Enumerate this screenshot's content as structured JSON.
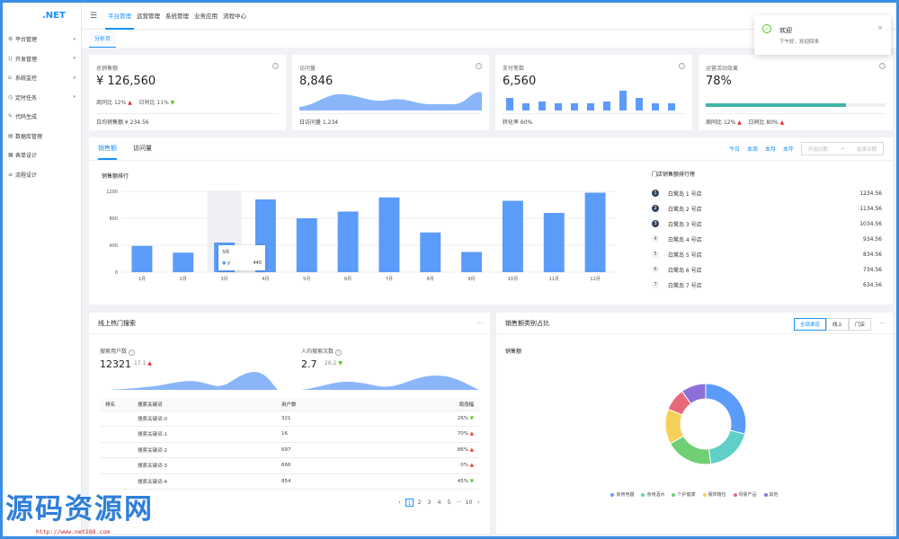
{
  "app": {
    "logo": ".NET"
  },
  "sidebar": {
    "items": [
      {
        "label": "平台管理",
        "icon": "gear-icon",
        "has_arrow": true
      },
      {
        "label": "开发管理",
        "icon": "code-icon",
        "has_arrow": true
      },
      {
        "label": "系统监控",
        "icon": "monitor-icon",
        "has_arrow": true
      },
      {
        "label": "定时任务",
        "icon": "clock-icon",
        "has_arrow": true
      },
      {
        "label": "代码生成",
        "icon": "code-gen-icon",
        "has_arrow": false
      },
      {
        "label": "数据库管理",
        "icon": "database-icon",
        "has_arrow": false
      },
      {
        "label": "表单设计",
        "icon": "form-icon",
        "has_arrow": false
      },
      {
        "label": "流程设计",
        "icon": "flow-icon",
        "has_arrow": false
      }
    ]
  },
  "header": {
    "nav": [
      "平台管理",
      "运营管理",
      "系统管理",
      "业务应用",
      "流程中心"
    ],
    "active": 0
  },
  "tabs": {
    "current": "分析页"
  },
  "stats": [
    {
      "title": "总销售额",
      "value": "¥ 126,560",
      "trend1_label": "周同比",
      "trend1": "12%",
      "trend2_label": "日同比",
      "trend2": "11%",
      "foot": "日均销售额 ¥ 234.56"
    },
    {
      "title": "访问量",
      "value": "8,846",
      "foot": "日访问量 1,234"
    },
    {
      "title": "支付笔数",
      "value": "6,560",
      "foot": "转化率 60%"
    },
    {
      "title": "运营活动效果",
      "value": "78%",
      "progress": 0.78,
      "foot_trend1_label": "周同比",
      "foot_trend1": "12%",
      "foot_trend2_label": "日同比",
      "foot_trend2": "80%"
    }
  ],
  "sales": {
    "tabs": [
      "销售额",
      "访问量"
    ],
    "ranges": [
      "今日",
      "本周",
      "本月",
      "本年"
    ],
    "date_start": "开始日期",
    "date_sep": "→",
    "date_end": "结束日期",
    "chart_title": "销售额排行",
    "ranking_title": "门店销售额排行榜",
    "ranking": [
      {
        "rank": "1",
        "name": "白鹭岛 1 号店",
        "value": "1234.56"
      },
      {
        "rank": "2",
        "name": "白鹭岛 2 号店",
        "value": "1134.56"
      },
      {
        "rank": "3",
        "name": "白鹭岛 3 号店",
        "value": "1034.56"
      },
      {
        "rank": "4",
        "name": "白鹭岛 4 号店",
        "value": "934.56"
      },
      {
        "rank": "5",
        "name": "白鹭岛 5 号店",
        "value": "834.56"
      },
      {
        "rank": "6",
        "name": "白鹭岛 6 号店",
        "value": "734.56"
      },
      {
        "rank": "7",
        "name": "白鹭岛 7 号店",
        "value": "634.56"
      }
    ],
    "tooltip": {
      "title": "3月",
      "series": "y",
      "value": "440"
    }
  },
  "chart_data": {
    "type": "bar",
    "categories": [
      "1月",
      "2月",
      "3月",
      "4月",
      "5月",
      "6月",
      "7月",
      "8月",
      "9月",
      "10月",
      "11月",
      "12月"
    ],
    "values": [
      390,
      290,
      440,
      1080,
      800,
      900,
      1110,
      590,
      300,
      1060,
      880,
      1180
    ],
    "ylim": [
      0,
      1200
    ],
    "yticks": [
      0,
      400,
      800,
      1200
    ],
    "highlight_index": 2,
    "grid": true,
    "color": "#5b9bfa"
  },
  "search": {
    "title": "线上热门搜索",
    "users_label": "搜索用户数",
    "users_value": "12321",
    "users_change": "17.1",
    "avg_label": "人均搜索次数",
    "avg_value": "2.7",
    "avg_change": "26.2",
    "columns": [
      "排名",
      "搜索关键词",
      "用户数",
      "周涨幅"
    ],
    "rows": [
      {
        "rank": "",
        "keyword": "搜索关键词-0",
        "users": "321",
        "change": "26%",
        "dir": "down"
      },
      {
        "rank": "",
        "keyword": "搜索关键词-1",
        "users": "16",
        "change": "70%",
        "dir": "up"
      },
      {
        "rank": "",
        "keyword": "搜索关键词-2",
        "users": "697",
        "change": "86%",
        "dir": "up"
      },
      {
        "rank": "",
        "keyword": "搜索关键词-3",
        "users": "666",
        "change": "0%",
        "dir": "up"
      },
      {
        "rank": "",
        "keyword": "搜索关键词-4",
        "users": "854",
        "change": "45%",
        "dir": "down"
      }
    ],
    "pages": [
      "1",
      "2",
      "3",
      "4",
      "5",
      "···",
      "10"
    ],
    "current_page": "1"
  },
  "category": {
    "title": "销售额类别占比",
    "switch": [
      "全部渠道",
      "线上",
      "门店"
    ],
    "active_switch": 0,
    "sub_title": "销售额"
  },
  "pie_data": {
    "type": "pie",
    "slices": [
      {
        "name": "家用电器",
        "value": 29,
        "color": "#5b9bfa"
      },
      {
        "name": "食用酒水",
        "value": 19,
        "color": "#5fcfc7"
      },
      {
        "name": "个护健康",
        "value": 19,
        "color": "#6fcf74"
      },
      {
        "name": "服饰箱包",
        "value": 14,
        "color": "#f4d05a"
      },
      {
        "name": "母婴产品",
        "value": 9,
        "color": "#e8687a"
      },
      {
        "name": "其他",
        "value": 10,
        "color": "#8e6fd8"
      }
    ]
  },
  "toast": {
    "title": "欢迎",
    "desc": "下午好，欢迎回来"
  },
  "watermark": {
    "text": "源码资源网",
    "url": "http://www.net188.com"
  }
}
